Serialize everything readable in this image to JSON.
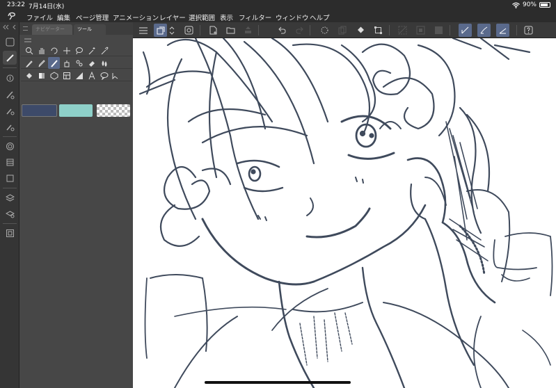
{
  "status_bar": {
    "time": "23:22",
    "date": "7月14日(水)",
    "battery": "90%"
  },
  "menu": {
    "items": [
      "ファイル",
      "編集",
      "ページ管理",
      "アニメーション",
      "レイヤー",
      "選択範囲",
      "表示",
      "フィルター",
      "ウィンドウ",
      "ヘルプ"
    ]
  },
  "panel": {
    "tab_navigator": "ナビゲーター",
    "tab_tool": "ツール"
  },
  "colors": {
    "main_color": "#3d4a69",
    "sub_color": "#8ed0c9",
    "accent": "#5a6a8c",
    "line_color": "#3f4a5c"
  },
  "tools": {
    "row1": [
      "zoom-icon",
      "hand-icon",
      "rotate-icon",
      "move-icon",
      "lasso-select-icon",
      "magic-wand-icon",
      "eyedropper-icon"
    ],
    "row2": [
      "pen-icon",
      "pencil-icon",
      "brush-icon",
      "airbrush-icon",
      "decoration-icon",
      "eraser-icon",
      "blend-icon"
    ],
    "row3": [
      "fill-icon",
      "gradient-icon",
      "figure-icon",
      "frame-border-icon",
      "ruler-icon",
      "text-icon",
      "balloon-icon",
      "correct-line-icon"
    ]
  }
}
